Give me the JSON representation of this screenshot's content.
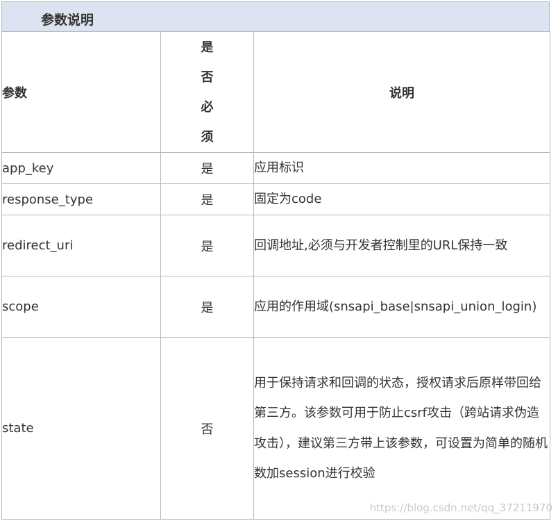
{
  "section_title": "参数说明",
  "table": {
    "headers": {
      "param": "参数",
      "required": "是否必须",
      "desc": "说明"
    },
    "rows": [
      {
        "param": "app_key",
        "required": "是",
        "desc": "应用标识"
      },
      {
        "param": "response_type",
        "required": "是",
        "desc": "固定为code"
      },
      {
        "param": "redirect_uri",
        "required": "是",
        "desc": "回调地址,必须与开发者控制里的URL保持一致"
      },
      {
        "param": "scope",
        "required": "是",
        "desc": "应用的作用域(snsapi_base|snsapi_union_login)"
      },
      {
        "param": "state",
        "required": "否",
        "desc": "用于保持请求和回调的状态，授权请求后原样带回给第三方。该参数可用于防止csrf攻击（跨站请求伪造攻击），建议第三方带上该参数，可设置为简单的随机数加session进行校验"
      }
    ]
  },
  "watermark": "https://blog.csdn.net/qq_37211970"
}
